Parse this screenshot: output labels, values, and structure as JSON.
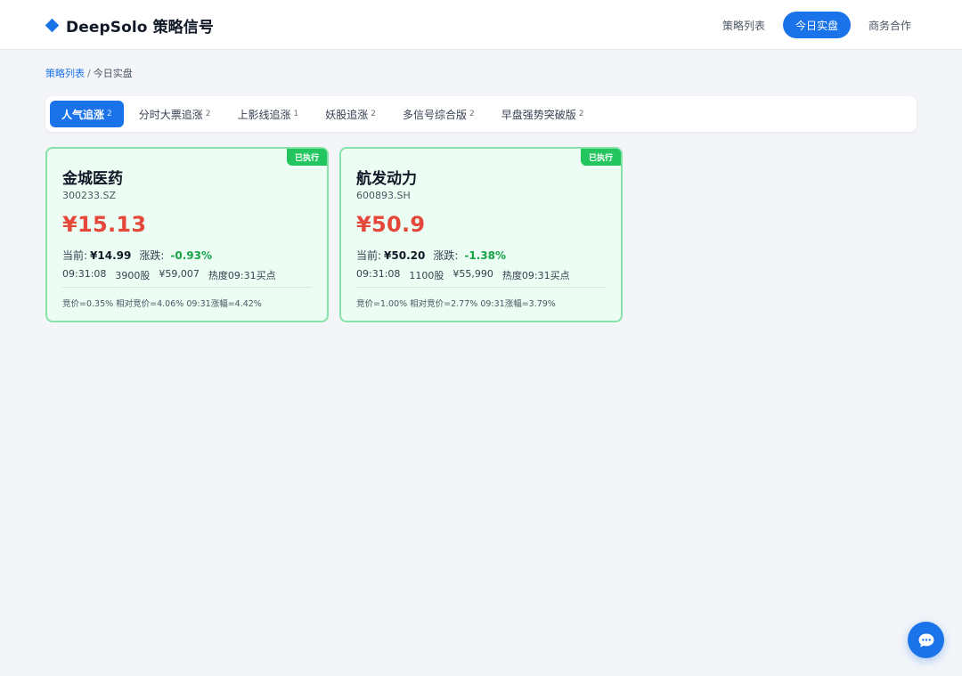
{
  "header": {
    "brand_icon": "diamond-icon",
    "brand": "DeepSolo 策略信号",
    "nav": [
      {
        "label": "策略列表",
        "active": false
      },
      {
        "label": "今日实盘",
        "active": true
      },
      {
        "label": "商务合作",
        "active": false
      }
    ]
  },
  "breadcrumb": {
    "link": "策略列表",
    "separator": "/",
    "current": "今日实盘"
  },
  "tabs": [
    {
      "label": "人气追涨",
      "count": "2",
      "active": true
    },
    {
      "label": "分时大票追涨",
      "count": "2",
      "active": false
    },
    {
      "label": "上影线追涨",
      "count": "1",
      "active": false
    },
    {
      "label": "妖股追涨",
      "count": "2",
      "active": false
    },
    {
      "label": "多信号综合版",
      "count": "2",
      "active": false
    },
    {
      "label": "早盘强势突破版",
      "count": "2",
      "active": false
    }
  ],
  "cards": [
    {
      "status": "已执行",
      "name": "金城医药",
      "code": "300233.SZ",
      "price": "¥15.13",
      "current_label": "当前:",
      "current_value": "¥14.99",
      "change_label": "涨跌:",
      "change_value": "-0.93%",
      "time": "09:31:08",
      "shares": "3900股",
      "amount": "¥59,007",
      "tag": "热度09:31买点",
      "note": "竞价=0.35% 相对竞价=4.06% 09:31涨幅=4.42%"
    },
    {
      "status": "已执行",
      "name": "航发动力",
      "code": "600893.SH",
      "price": "¥50.9",
      "current_label": "当前:",
      "current_value": "¥50.20",
      "change_label": "涨跌:",
      "change_value": "-1.38%",
      "time": "09:31:08",
      "shares": "1100股",
      "amount": "¥55,990",
      "tag": "热度09:31买点",
      "note": "竞价=1.00% 相对竞价=2.77% 09:31涨幅=3.79%"
    }
  ],
  "colors": {
    "accent": "#1a73e8",
    "price_red": "#e5473a",
    "change_green": "#16a34a",
    "executed_badge": "#22c55e",
    "card_bg": "#ecfdf3"
  },
  "chat_icon": "chat-bubble-icon"
}
